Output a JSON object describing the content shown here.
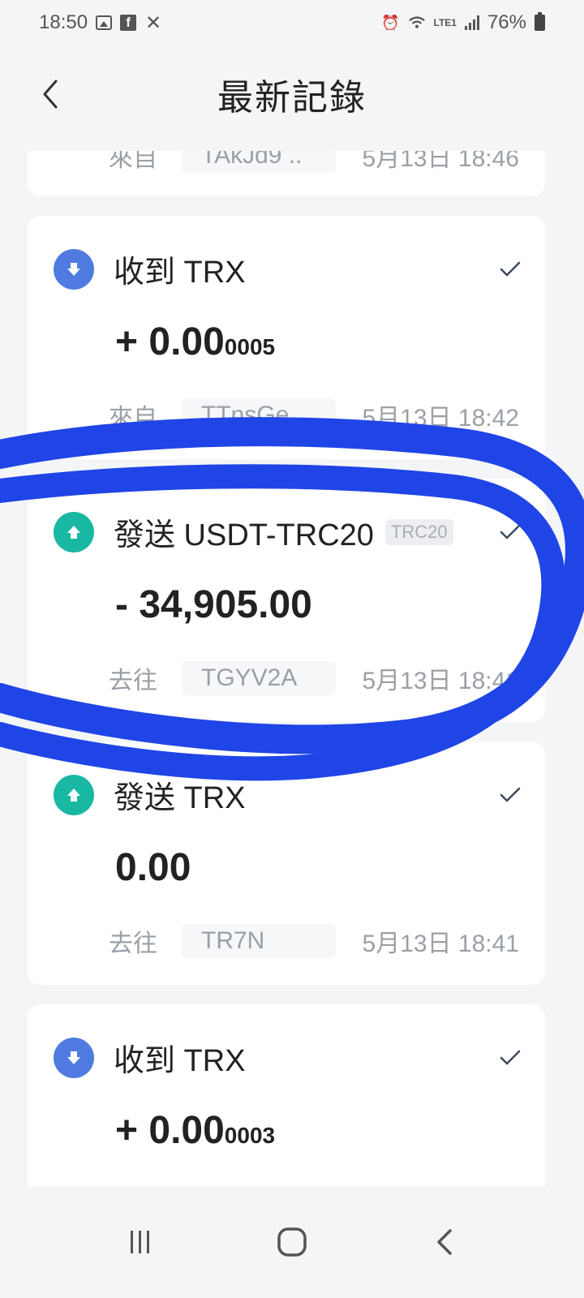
{
  "status_bar": {
    "time": "18:50",
    "battery": "76%",
    "network": "LTE1"
  },
  "header": {
    "title": "最新記錄"
  },
  "colors": {
    "receive_icon": "#4f7be0",
    "send_icon": "#19b8a2",
    "ink_annotation": "#1f45e6"
  },
  "partial_record": {
    "label": "來自",
    "address": "TAkJd9 ..",
    "time": "5月13日 18:46"
  },
  "records": [
    {
      "direction": "receive",
      "title": "收到 TRX",
      "badge": "",
      "amount_main": "+ 0.00",
      "amount_small": "0005",
      "label": "來自",
      "address": "TTnsGe",
      "time": "5月13日 18:42"
    },
    {
      "direction": "send",
      "title": "發送 USDT-TRC20",
      "badge": "TRC20",
      "amount_main": "- 34,905.00",
      "amount_small": "",
      "label": "去往",
      "address": "TGYV2A",
      "time": "5月13日 18:41"
    },
    {
      "direction": "send",
      "title": "發送 TRX",
      "badge": "",
      "amount_main": "0.00",
      "amount_small": "",
      "label": "去往",
      "address": "TR7N",
      "time": "5月13日 18:41"
    },
    {
      "direction": "receive",
      "title": "收到 TRX",
      "badge": "",
      "amount_main": "+ 0.00",
      "amount_small": "0003",
      "label": "",
      "address": "",
      "time": ""
    }
  ],
  "nav": {
    "recent_icon": "recent-apps-icon",
    "home_icon": "home-icon",
    "back_icon": "back-icon"
  }
}
